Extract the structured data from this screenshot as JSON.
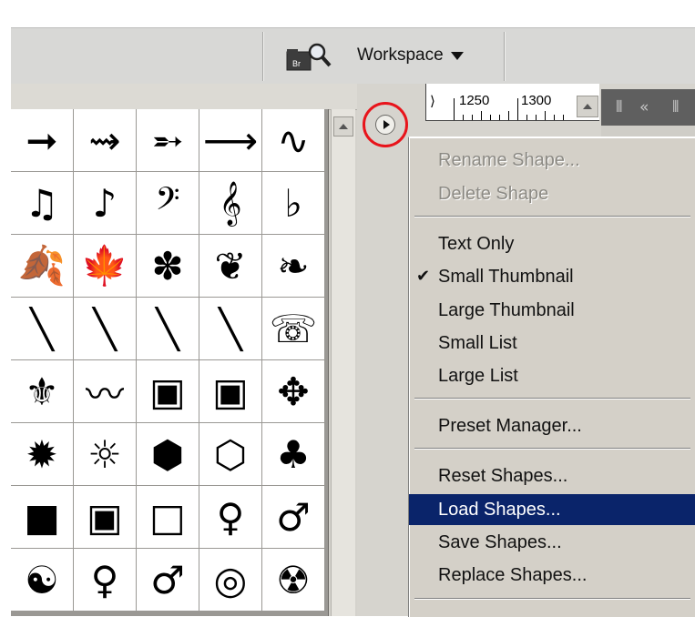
{
  "toolbar": {
    "workspace_label": "Workspace"
  },
  "ruler": {
    "labels": [
      "1250",
      "1300"
    ]
  },
  "shapes_grid": {
    "cells": [
      "arrow-right-bold",
      "arrow-wavy",
      "arrow-feathered",
      "arrow-thin",
      "arrow-squiggle",
      "music-notes-beamed",
      "music-note-eighth",
      "bass-clef",
      "treble-clef",
      "flat-sign",
      "leaf-1",
      "leaf-maple",
      "flower",
      "floral-ornament-1",
      "floral-ornament-2",
      "pencil-1",
      "pencil-2",
      "pencil-3",
      "pencil-4",
      "telephone",
      "fleur-de-lis",
      "scroll-ornament",
      "ornament-frame-1",
      "ornament-frame-2",
      "diamond-ornament",
      "sunburst",
      "sun-outline",
      "hexagon-filled",
      "hexagon-outline",
      "club",
      "square-filled",
      "square-frame",
      "square-outline",
      "female-figure",
      "male-figure",
      "yin-yang",
      "female-symbol",
      "male-symbol",
      "target",
      "radioactive"
    ],
    "glyphs": [
      "➞",
      "⇝",
      "➵",
      "⟶",
      "∿",
      "♫",
      "♪",
      "𝄢",
      "𝄞",
      "♭",
      "🍂",
      "🍁",
      "✽",
      "❦",
      "❧",
      "╲",
      "╲",
      "╲",
      "╲",
      "☏",
      "⚜",
      "〰",
      "▣",
      "▣",
      "✥",
      "✹",
      "☼",
      "⬢",
      "⬡",
      "♣",
      "■",
      "▣",
      "□",
      "♀",
      "♂",
      "☯",
      "♀",
      "♂",
      "◎",
      "☢"
    ]
  },
  "menu": {
    "items": [
      {
        "label": "Rename Shape...",
        "state": "disabled"
      },
      {
        "label": "Delete Shape",
        "state": "disabled"
      },
      {
        "label": "Text Only",
        "state": "normal"
      },
      {
        "label": "Small Thumbnail",
        "state": "checked"
      },
      {
        "label": "Large Thumbnail",
        "state": "normal"
      },
      {
        "label": "Small List",
        "state": "normal"
      },
      {
        "label": "Large List",
        "state": "normal"
      },
      {
        "label": "Preset Manager...",
        "state": "normal"
      },
      {
        "label": "Reset Shapes...",
        "state": "normal"
      },
      {
        "label": "Load Shapes...",
        "state": "selected"
      },
      {
        "label": "Save Shapes...",
        "state": "normal"
      },
      {
        "label": "Replace Shapes...",
        "state": "normal"
      }
    ],
    "check_glyph": "✔"
  },
  "colors": {
    "menu_bg": "#d4d0c8",
    "selection": "#0a246a",
    "highlight_ring": "#e8141b",
    "disabled_text": "#8c8a84"
  },
  "icons": {
    "browse": "file-browser-magnifier-icon",
    "menu_flyout": "panel-flyout-arrow-icon",
    "dropdown": "triangle-down-icon"
  }
}
